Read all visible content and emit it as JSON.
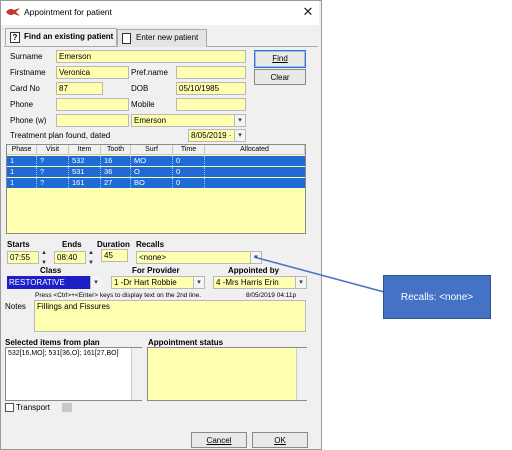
{
  "window": {
    "title": "Appointment for patient",
    "close_glyph": "✕"
  },
  "tabs": [
    {
      "label": "Find an existing patient",
      "icon": "question-icon",
      "active": true
    },
    {
      "label": "Enter new patient",
      "icon": "new-document-icon",
      "active": false
    }
  ],
  "patient": {
    "surname_label": "Surname",
    "surname": "Emerson",
    "firstname_label": "Firstname",
    "firstname": "Veronica",
    "prefname_label": "Pref.name",
    "prefname": "",
    "cardno_label": "Card No",
    "cardno": "87",
    "dob_label": "DOB",
    "dob": "05/10/1985",
    "phone_label": "Phone",
    "phone": "",
    "mobile_label": "Mobile",
    "mobile": "",
    "phonew_label": "Phone (w)",
    "phonew": "",
    "account_name": "Emerson"
  },
  "buttons": {
    "find": "Find",
    "clear": "Clear",
    "cancel": "Cancel",
    "ok": "OK"
  },
  "treatment_plan": {
    "label": "Treatment plan found, dated",
    "date": "8/05/2019 ·"
  },
  "plan_table": {
    "columns": [
      "Phase",
      "Visit",
      "Item",
      "Tooth",
      "Surf",
      "Time",
      "Allocated"
    ],
    "rows": [
      [
        "1",
        "?",
        "532",
        "16",
        "MO",
        "0",
        ""
      ],
      [
        "1",
        "?",
        "531",
        "36",
        "O",
        "0",
        ""
      ],
      [
        "1",
        "?",
        "161",
        "27",
        "BO",
        "0",
        ""
      ]
    ]
  },
  "timing": {
    "starts_label": "Starts",
    "starts": "07:55",
    "ends_label": "Ends",
    "ends": "08:40",
    "duration_label": "Duration",
    "duration": "45",
    "recalls_label": "Recalls",
    "recalls": "<none>"
  },
  "class": {
    "label": "Class",
    "value": "RESTORATIVE",
    "color": "#1e1ec8"
  },
  "provider": {
    "label": "For Provider",
    "value": "1 -Dr Hart Robbie"
  },
  "appointed_by": {
    "label": "Appointed by",
    "value": "4 -Mrs Harris Erin"
  },
  "notes": {
    "hint": "Press <Ctrl>+<Enter> keys to display text on the 2nd line.",
    "timestamp": "8/05/2019 04:11p",
    "label": "Notes",
    "value": "Fillings and Fissures"
  },
  "selected_items": {
    "label": "Selected items from plan",
    "value": "532[16,MO]; 531[36,O]; 161[27,BO]"
  },
  "appointment_status": {
    "label": "Appointment status"
  },
  "transport": {
    "label": "Transport",
    "checked": false
  },
  "callout": {
    "text": "Recalls: <none>",
    "color": "#4472c4"
  }
}
